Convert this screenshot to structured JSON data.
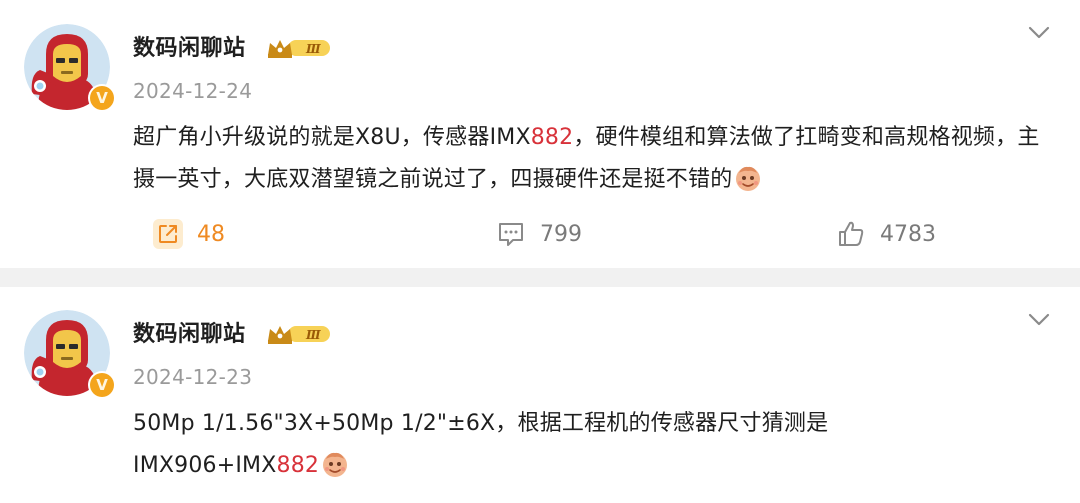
{
  "colors": {
    "highlight": "#d8323a",
    "repost_accent": "#ef8a22",
    "separator": "#f1f1f1",
    "verified_badge": "#f4a51c"
  },
  "posts": [
    {
      "username": "数码闲聊站",
      "level_badge_icon": "crown-level-iii-badge",
      "level_text": "Ⅲ",
      "verified_icon": "verified-v-icon",
      "verified_text": "V",
      "date": "2024-12-24",
      "content_parts": {
        "p1": "超广角小升级说的就是X8U，传感器IMX",
        "hl1": "882",
        "p2": "，硬件模组和算法做了扛畸变和高规格视频，主摄一英寸，大底双潜望镜之前说过了，四摄硬件还是挺不错的"
      },
      "emoji_icon": "doge-emoji",
      "actions": {
        "repost_count": "48",
        "comment_count": "799",
        "like_count": "4783"
      }
    },
    {
      "username": "数码闲聊站",
      "level_badge_icon": "crown-level-iii-badge",
      "level_text": "Ⅲ",
      "verified_icon": "verified-v-icon",
      "verified_text": "V",
      "date": "2024-12-23",
      "content_parts": {
        "p1": "50Mp 1/1.56\"3X+50Mp 1/2\"±6X，根据工程机的传感器尺寸猜测是",
        "p2": "IMX906+IMX",
        "hl1": "882"
      },
      "emoji_icon": "doge-emoji"
    }
  ]
}
